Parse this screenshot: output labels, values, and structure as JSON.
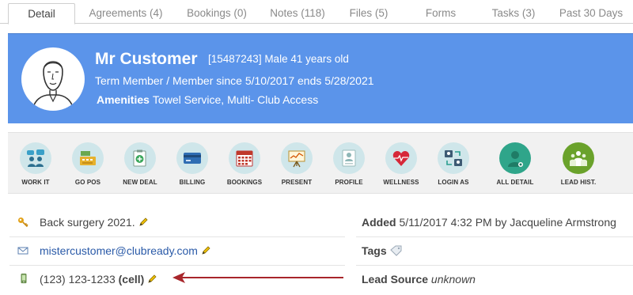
{
  "tabs": [
    {
      "label": "Detail",
      "active": true
    },
    {
      "label": "Agreements (4)",
      "active": false
    },
    {
      "label": "Bookings (0)",
      "active": false
    },
    {
      "label": "Notes (118)",
      "active": false
    },
    {
      "label": "Files (5)",
      "active": false
    },
    {
      "label": "Forms",
      "active": false
    },
    {
      "label": "Tasks (3)",
      "active": false
    },
    {
      "label": "Past 30 Days",
      "active": false
    }
  ],
  "header": {
    "name": "Mr Customer",
    "id_line": "[15487243]  Male 41 years old",
    "membership": "Term Member / Member since 5/10/2017 ends 5/28/2021",
    "amenities_label": "Amenities",
    "amenities": "Towel Service, Multi- Club Access",
    "banner_color": "#5b94ea"
  },
  "toolbar": [
    {
      "label": "WORK IT",
      "icon": "chat-people-icon"
    },
    {
      "label": "GO POS",
      "icon": "cash-register-icon"
    },
    {
      "label": "NEW DEAL",
      "icon": "clipboard-plus-icon"
    },
    {
      "label": "BILLING",
      "icon": "credit-card-icon"
    },
    {
      "label": "BOOKINGS",
      "icon": "calendar-icon"
    },
    {
      "label": "PRESENT",
      "icon": "presentation-board-icon"
    },
    {
      "label": "PROFILE",
      "icon": "profile-document-icon"
    },
    {
      "label": "WELLNESS",
      "icon": "heart-pulse-icon"
    },
    {
      "label": "LOGIN AS",
      "icon": "switch-user-icon"
    },
    {
      "label": "ALL DETAIL",
      "icon": "person-detail-icon"
    },
    {
      "label": "LEAD HIST.",
      "icon": "group-people-icon"
    }
  ],
  "details": {
    "note": "Back surgery 2021.",
    "email": "mistercustomer@clubready.com",
    "phone": "(123) 123-1233",
    "phone_type": "(cell)",
    "added_label": "Added",
    "added_value": "5/11/2017 4:32 PM by Jacqueline Armstrong",
    "tags_label": "Tags",
    "lead_source_label": "Lead Source",
    "lead_source_value": "unknown"
  }
}
